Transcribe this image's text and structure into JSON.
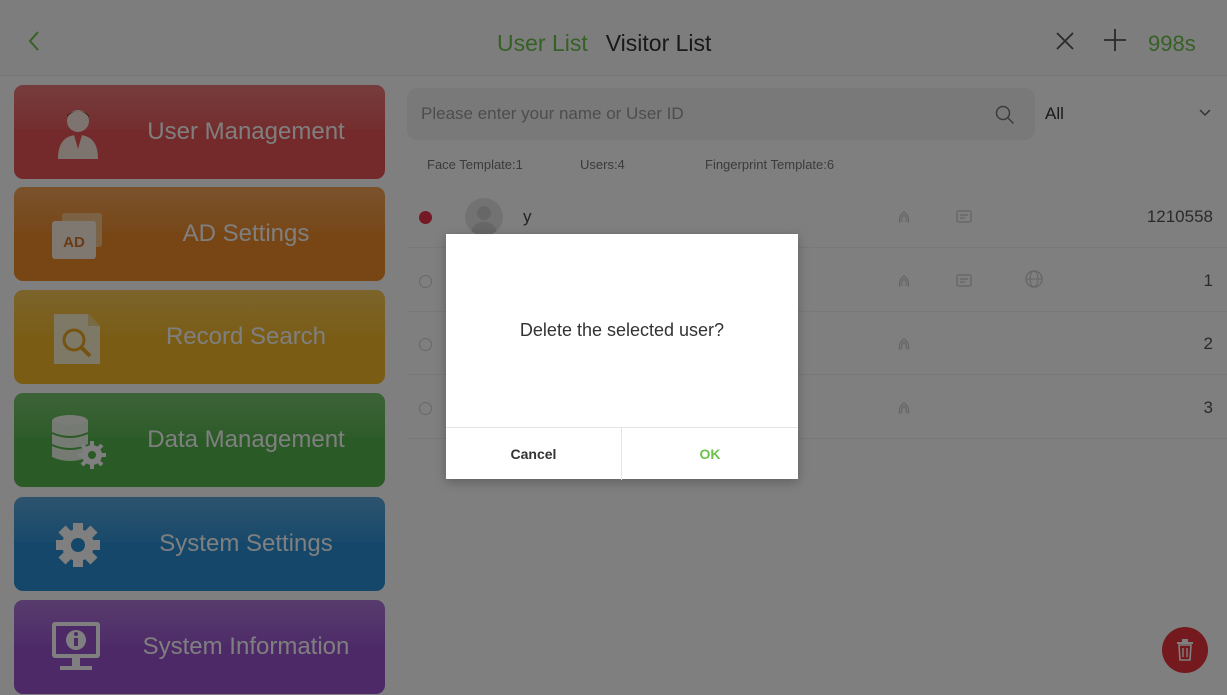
{
  "header": {
    "back_icon": "chevron-left-icon",
    "tabs": [
      {
        "label": "User List",
        "active": true
      },
      {
        "label": "Visitor List",
        "active": false
      }
    ],
    "close_icon": "close-icon",
    "add_icon": "plus-icon",
    "countdown": "998s",
    "accent_color": "#6cc24a"
  },
  "sidebar": {
    "items": [
      {
        "label": "User Management",
        "color": "#e85455",
        "icon": "user-icon"
      },
      {
        "label": "AD Settings",
        "color": "#f08b2a",
        "icon": "ad-icon",
        "icon_text": "AD"
      },
      {
        "label": "Record Search",
        "color": "#f5b828",
        "icon": "record-search-icon"
      },
      {
        "label": "Data Management",
        "color": "#55b54b",
        "icon": "database-gear-icon"
      },
      {
        "label": "System Settings",
        "color": "#2a8fd4",
        "icon": "gear-icon"
      },
      {
        "label": "System Information",
        "color": "#9a52d0",
        "icon": "monitor-info-icon"
      }
    ]
  },
  "search": {
    "placeholder": "Please enter your name or User ID",
    "value": "",
    "icon": "search-icon"
  },
  "filter": {
    "selected": "All",
    "icon": "chevron-down-icon"
  },
  "stats": {
    "face": "Face Template:1",
    "users": "Users:4",
    "fingerprint": "Fingerprint Template:6"
  },
  "users": [
    {
      "name": "y",
      "id": "1210558",
      "checked": true,
      "fingerprint": true,
      "card": true,
      "face": false
    },
    {
      "name": "",
      "id": "1",
      "checked": false,
      "fingerprint": true,
      "card": true,
      "face": true
    },
    {
      "name": "",
      "id": "2",
      "checked": false,
      "fingerprint": true,
      "card": false,
      "face": false
    },
    {
      "name": "",
      "id": "3",
      "checked": false,
      "fingerprint": true,
      "card": false,
      "face": false
    }
  ],
  "delete_fab": {
    "icon": "trash-icon",
    "color": "#e8333b"
  },
  "dialog": {
    "message": "Delete the selected user?",
    "cancel_label": "Cancel",
    "ok_label": "OK"
  }
}
